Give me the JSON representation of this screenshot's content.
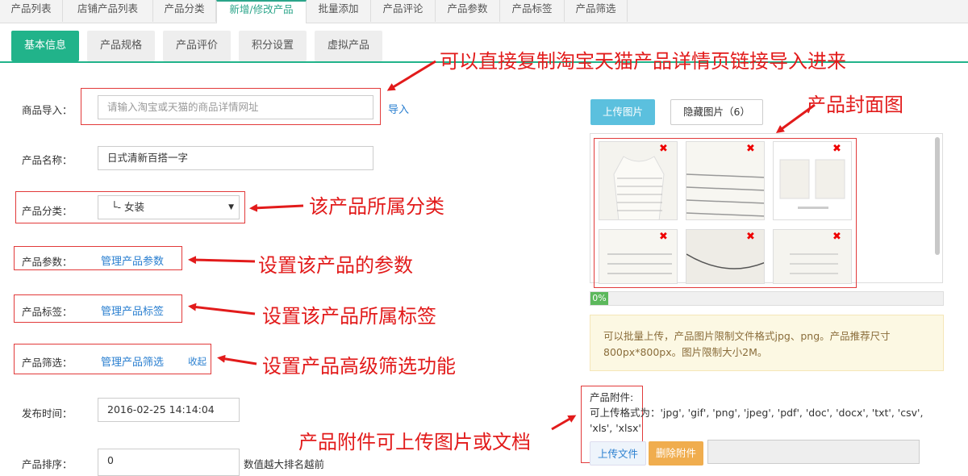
{
  "top_tabs": [
    "产品列表",
    "店铺产品列表",
    "产品分类",
    "新增/修改产品",
    "批量添加",
    "产品评论",
    "产品参数",
    "产品标签",
    "产品筛选"
  ],
  "sub_tabs": [
    "基本信息",
    "产品规格",
    "产品评价",
    "积分设置",
    "虚拟产品"
  ],
  "form": {
    "import_label": "商品导入：",
    "import_placeholder": "请输入淘宝或天猫的商品详情网址",
    "import_link": "导入",
    "name_label": "产品名称：",
    "name_value": "日式清新百搭一字",
    "category_label": "产品分类：",
    "category_value": "└- 女装",
    "params_label": "产品参数：",
    "params_link": "管理产品参数",
    "tags_label": "产品标签：",
    "tags_link": "管理产品标签",
    "filter_label": "产品筛选：",
    "filter_link": "管理产品筛选",
    "filter_collapse": "收起",
    "publish_label": "发布时间：",
    "publish_value": "2016-02-25 14:14:04",
    "sort_label": "产品排序：",
    "sort_value": "0",
    "sort_hint": "数值越大排名越前"
  },
  "images": {
    "upload_button": "上传图片",
    "hide_button": "隐藏图片（6）",
    "progress": "0%",
    "progress_value": 0,
    "notice": "可以批量上传，产品图片限制文件格式jpg、png。产品推荐尺寸800px*800px。图片限制大小2M。",
    "thumbnails": [
      "sweater-photo-1",
      "sweater-photo-2",
      "sweater-photo-3",
      "sweater-photo-4",
      "sweater-photo-5",
      "sweater-photo-6"
    ],
    "delete_mark": "✖"
  },
  "attachment": {
    "title": "产品附件:",
    "formats": "可上传格式为：'jpg', 'gif', 'png', 'jpeg', 'pdf', 'doc', 'docx', 'txt', 'csv', 'xls', 'xlsx'",
    "upload_button": "上传文件",
    "delete_button": "删除附件"
  },
  "annotations": {
    "import": "可以直接复制淘宝天猫产品详情页链接导入进来",
    "cover": "产品封面图",
    "category": "该产品所属分类",
    "params": "设置该产品的参数",
    "tags": "设置该产品所属标签",
    "filter": "设置产品高级筛选功能",
    "attachment": "产品附件可上传图片或文档"
  },
  "colors": {
    "accent": "#21b38a",
    "annotation_red": "#e21b1b",
    "link_blue": "#2a7fd0",
    "upload_blue": "#5bc0de",
    "delete_orange": "#f0ad4e"
  }
}
